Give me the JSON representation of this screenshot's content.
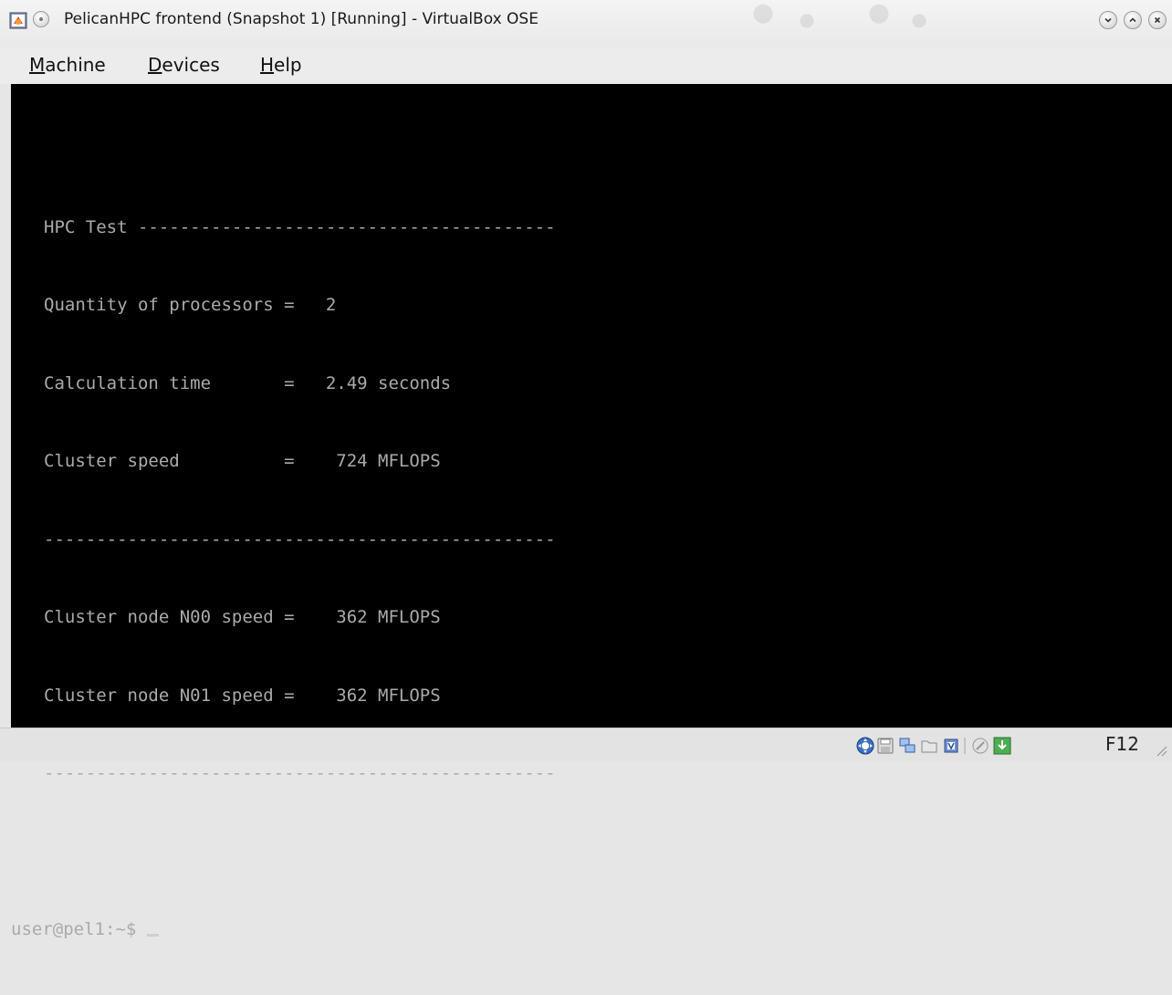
{
  "window": {
    "title": "PelicanHPC frontend (Snapshot 1) [Running] - VirtualBox OSE",
    "app_icon": "virtualbox-app-icon",
    "controls": [
      "minimize-icon",
      "maximize-icon",
      "close-icon"
    ]
  },
  "menubar": {
    "items": [
      {
        "label": "Machine",
        "accel": "M",
        "rest": "achine"
      },
      {
        "label": "Devices",
        "accel": "D",
        "rest": "evices"
      },
      {
        "label": "Help",
        "accel": "H",
        "rest": "elp"
      }
    ]
  },
  "console": {
    "lines": [
      "",
      "HPC Test ----------------------------------------",
      "Quantity of processors =   2",
      "Calculation time       =   2.49 seconds",
      "Cluster speed          =    724 MFLOPS",
      "-------------------------------------------------",
      "Cluster node N00 speed =    362 MFLOPS",
      "Cluster node N01 speed =    362 MFLOPS",
      "-------------------------------------------------",
      "",
      "user@pel1:~$ "
    ],
    "text_color": "#aaaaaa",
    "background": "#000000"
  },
  "statusbar": {
    "icons": [
      "mouse-integration-icon",
      "floppy-disk-icon",
      "network-icon",
      "shared-folder-icon",
      "virtualization-chip-icon",
      "usb-icon",
      "host-key-capture-icon"
    ],
    "host_key": "F12"
  }
}
